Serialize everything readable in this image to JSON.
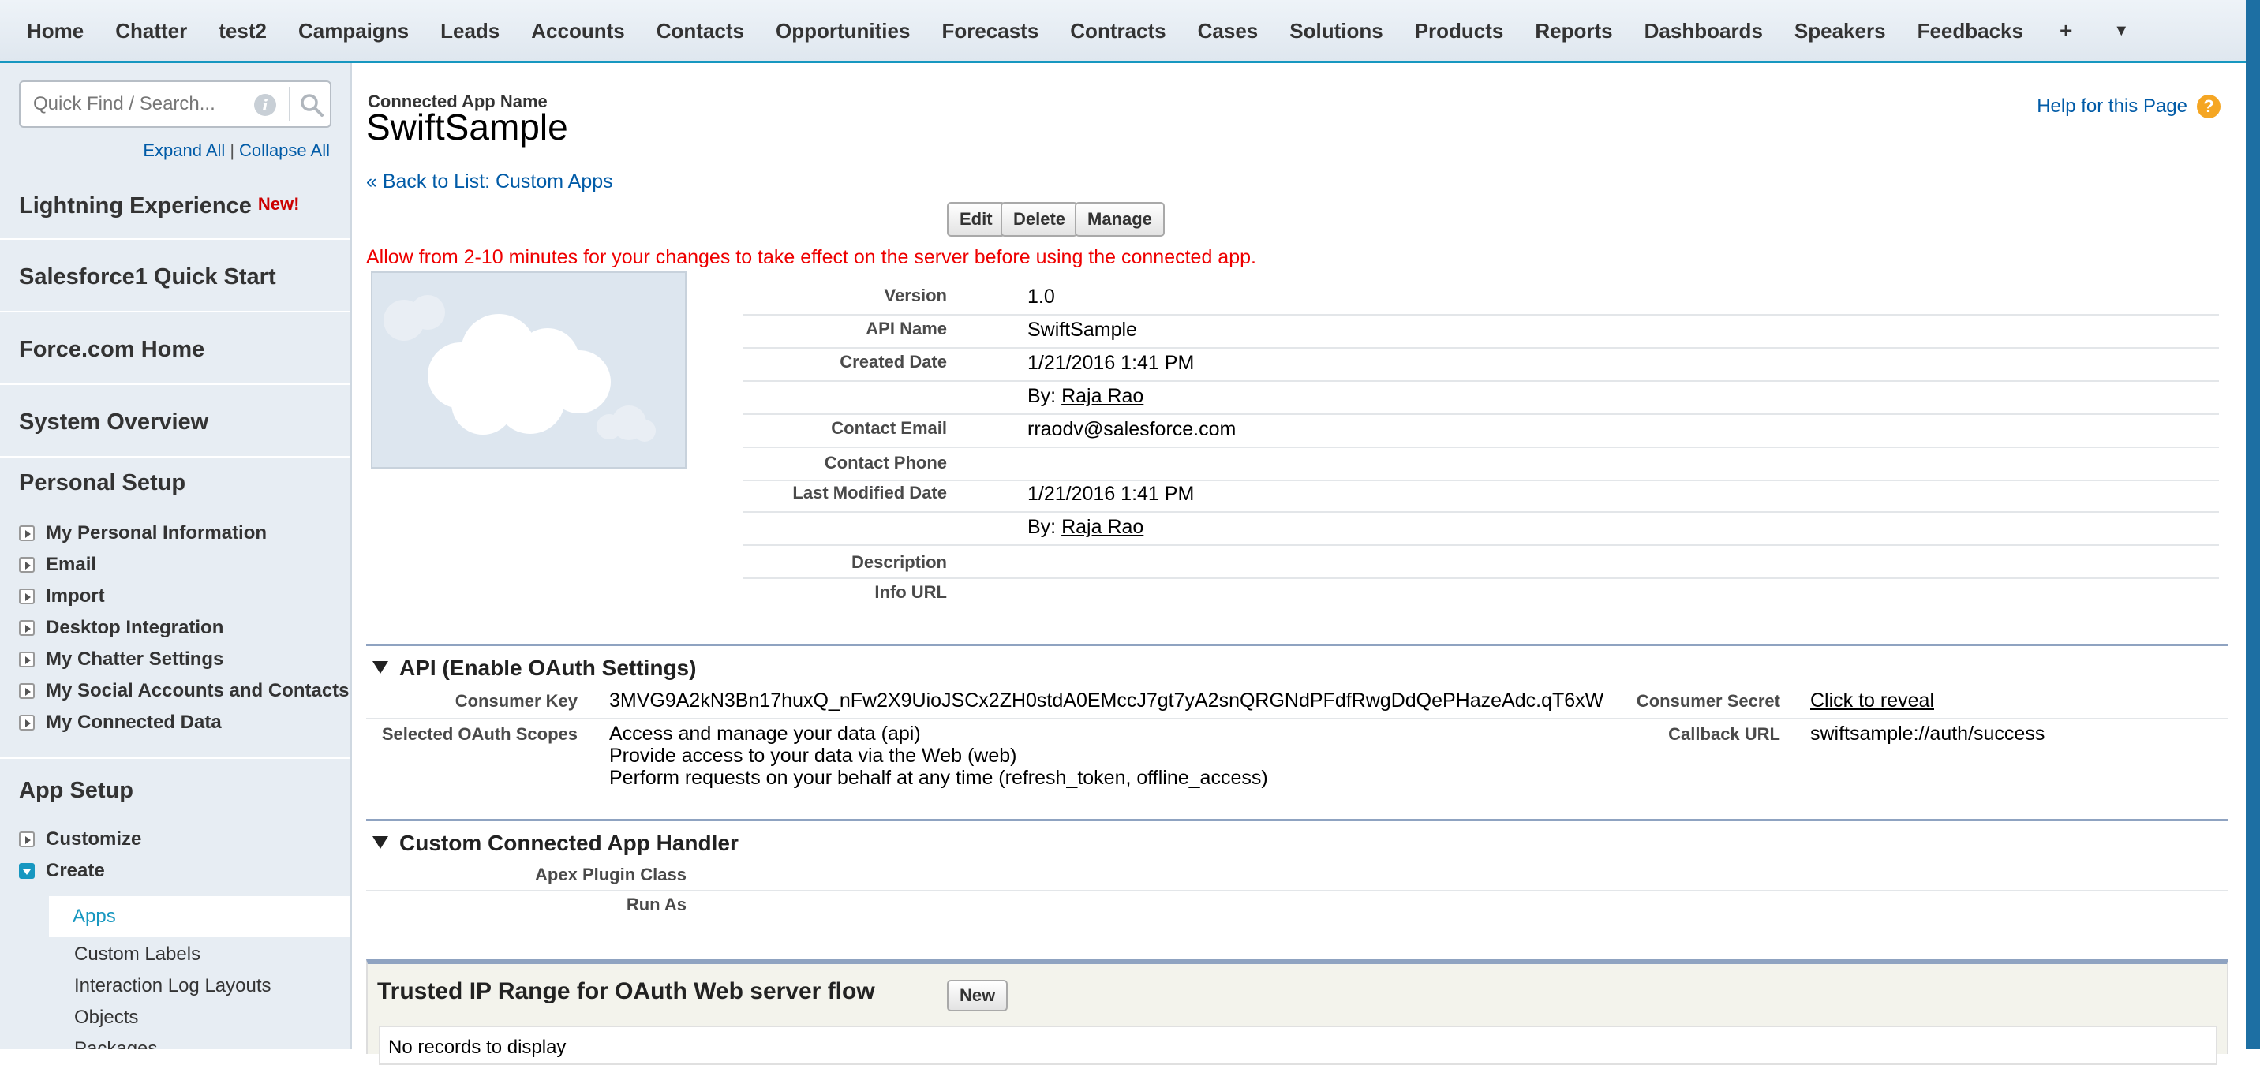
{
  "nav": {
    "tabs": [
      "Home",
      "Chatter",
      "test2",
      "Campaigns",
      "Leads",
      "Accounts",
      "Contacts",
      "Opportunities",
      "Forecasts",
      "Contracts",
      "Cases",
      "Solutions",
      "Products",
      "Reports",
      "Dashboards",
      "Speakers",
      "Feedbacks"
    ],
    "plus_icon": "+",
    "more_icon": "▼"
  },
  "sidebar": {
    "search_placeholder": "Quick Find / Search...",
    "expand_all": "Expand All",
    "separator": "|",
    "collapse_all": "Collapse All",
    "lightning": "Lightning Experience",
    "new_badge": "New!",
    "sf1": "Salesforce1 Quick Start",
    "force_home": "Force.com Home",
    "system_overview": "System Overview",
    "personal_setup": "Personal Setup",
    "personal_items": [
      "My Personal Information",
      "Email",
      "Import",
      "Desktop Integration",
      "My Chatter Settings",
      "My Social Accounts and Contacts",
      "My Connected Data"
    ],
    "app_setup": "App Setup",
    "customize": "Customize",
    "create": "Create",
    "create_items": [
      "Apps",
      "Custom Labels",
      "Interaction Log Layouts",
      "Objects",
      "Packages"
    ]
  },
  "main": {
    "label": "Connected App Name",
    "title": "SwiftSample",
    "help": "Help for this Page",
    "help_icon": "?",
    "back": "« Back to List: Custom Apps",
    "buttons": {
      "edit": "Edit",
      "delete": "Delete",
      "manage": "Manage"
    },
    "warning": "Allow from 2-10 minutes for your changes to take effect on the server before using the connected app.",
    "details": {
      "version_label": "Version",
      "version": "1.0",
      "api_name_label": "API Name",
      "api_name": "SwiftSample",
      "created_label": "Created Date",
      "created": "1/21/2016 1:41 PM",
      "by": "By:",
      "created_by": "Raja Rao",
      "email_label": "Contact Email",
      "email": "rraodv@salesforce.com",
      "phone_label": "Contact Phone",
      "modified_label": "Last Modified Date",
      "modified": "1/21/2016 1:41 PM",
      "modified_by": "Raja Rao",
      "description_label": "Description",
      "info_url_label": "Info URL"
    },
    "api": {
      "heading": "API (Enable OAuth Settings)",
      "consumer_key_label": "Consumer Key",
      "consumer_key": "3MVG9A2kN3Bn17huxQ_nFw2X9UioJSCx2ZH0stdA0EMccJ7gt7yA2snQRGNdPFdfRwgDdQePHazeAdc.qT6xW",
      "consumer_secret_label": "Consumer Secret",
      "consumer_secret": "Click to reveal",
      "scopes_label": "Selected OAuth Scopes",
      "scopes": [
        "Access and manage your data (api)",
        "Provide access to your data via the Web (web)",
        "Perform requests on your behalf at any time (refresh_token, offline_access)"
      ],
      "callback_label": "Callback URL",
      "callback": "swiftsample://auth/success"
    },
    "handler": {
      "heading": "Custom Connected App Handler",
      "apex_label": "Apex Plugin Class",
      "run_as_label": "Run As"
    },
    "trusted": {
      "heading": "Trusted IP Range for OAuth Web server flow",
      "new_button": "New",
      "empty": "No records to display"
    }
  },
  "colors": {
    "accent": "#1797c0",
    "link": "#015ba7",
    "warning": "#e00000"
  }
}
